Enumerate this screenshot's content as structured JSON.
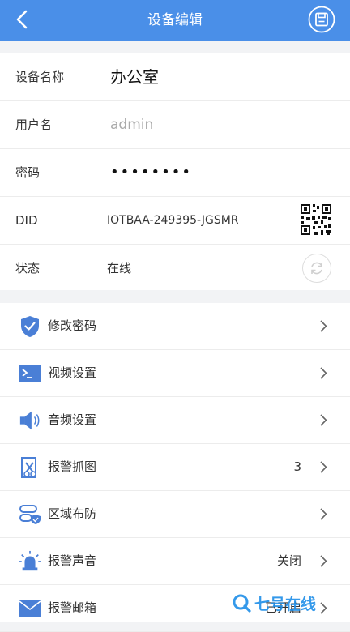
{
  "header": {
    "title": "设备编辑",
    "back_icon": "chevron-left-icon",
    "save_icon": "save-icon",
    "color": "#4a8fe8"
  },
  "info": {
    "name": {
      "label": "设备名称",
      "value": "办公室"
    },
    "username": {
      "label": "用户名",
      "placeholder": "admin"
    },
    "password": {
      "label": "密码",
      "value": "••••••••"
    },
    "did": {
      "label": "DID",
      "value": "IOTBAA-249395-JGSMR",
      "icon": "qr-code-icon"
    },
    "status": {
      "label": "状态",
      "value": "在线",
      "icon": "refresh-icon"
    }
  },
  "menu": {
    "items": [
      {
        "label": "修改密码",
        "icon": "shield-check-icon",
        "value": ""
      },
      {
        "label": "视频设置",
        "icon": "terminal-icon",
        "value": ""
      },
      {
        "label": "音频设置",
        "icon": "speaker-icon",
        "value": ""
      },
      {
        "label": "报警抓图",
        "icon": "snapshot-icon",
        "value": "3"
      },
      {
        "label": "区域布防",
        "icon": "zone-shield-icon",
        "value": ""
      },
      {
        "label": "报警声音",
        "icon": "siren-icon",
        "value": "关闭"
      },
      {
        "label": "报警邮箱",
        "icon": "mail-icon",
        "value": "已开启"
      }
    ]
  },
  "watermark": {
    "text": "七号在线"
  },
  "colors": {
    "accent": "#4a8fe8",
    "icon_blue": "#4a7fd6",
    "divider": "#ececec"
  }
}
